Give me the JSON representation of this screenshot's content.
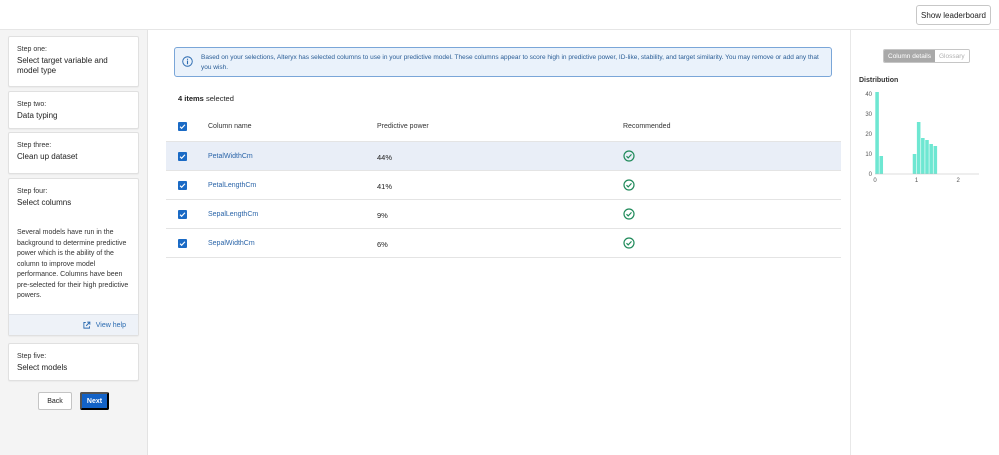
{
  "header": {
    "leaderboard_label": "Show leaderboard"
  },
  "steps": [
    {
      "label": "Step one:",
      "title": "Select target variable and model type"
    },
    {
      "label": "Step two:",
      "title": "Data typing"
    },
    {
      "label": "Step three:",
      "title": "Clean up dataset"
    },
    {
      "label": "Step four:",
      "title": "Select columns",
      "description": "Several models have run in the background to determine predictive power which is the ability of the column to improve model performance. Columns have been pre-selected for their high predictive powers.",
      "help_label": "View help"
    },
    {
      "label": "Step five:",
      "title": "Select models"
    }
  ],
  "nav": {
    "back_label": "Back",
    "next_label": "Next"
  },
  "info": {
    "text": "Based on your selections, Alteryx has selected columns to use in your predictive model. These columns appear to score high in predictive power, ID-like, stability, and target similarity. You may remove or add any that you wish."
  },
  "selection": {
    "count": "4 items",
    "suffix": "selected"
  },
  "table": {
    "headers": {
      "name": "Column name",
      "power": "Predictive power",
      "recommended": "Recommended"
    },
    "rows": [
      {
        "name": "PetalWidthCm",
        "power": "44%",
        "recommended": true,
        "checked": true
      },
      {
        "name": "PetalLengthCm",
        "power": "41%",
        "recommended": true,
        "checked": true
      },
      {
        "name": "SepalLengthCm",
        "power": "9%",
        "recommended": true,
        "checked": true
      },
      {
        "name": "SepalWidthCm",
        "power": "6%",
        "recommended": true,
        "checked": true
      }
    ]
  },
  "details": {
    "tab_active": "Column details",
    "tab_inactive": "Glossary",
    "distribution_title": "Distribution"
  },
  "chart_data": {
    "type": "bar",
    "y_ticks": [
      "0",
      "10",
      "20",
      "30",
      "40"
    ],
    "x_ticks": [
      "0",
      "1",
      "2"
    ],
    "ylim": [
      0,
      40
    ],
    "xlim": [
      0,
      2.5
    ],
    "bin_width": 0.1,
    "bins": [
      {
        "x": 0.0,
        "value": 41
      },
      {
        "x": 0.1,
        "value": 9
      },
      {
        "x": 0.3,
        "value": 0
      },
      {
        "x": 0.9,
        "value": 10
      },
      {
        "x": 1.0,
        "value": 26
      },
      {
        "x": 1.1,
        "value": 18
      },
      {
        "x": 1.2,
        "value": 17
      },
      {
        "x": 1.3,
        "value": 15
      },
      {
        "x": 1.4,
        "value": 14
      }
    ],
    "bar_color": "#6ee7d2"
  }
}
